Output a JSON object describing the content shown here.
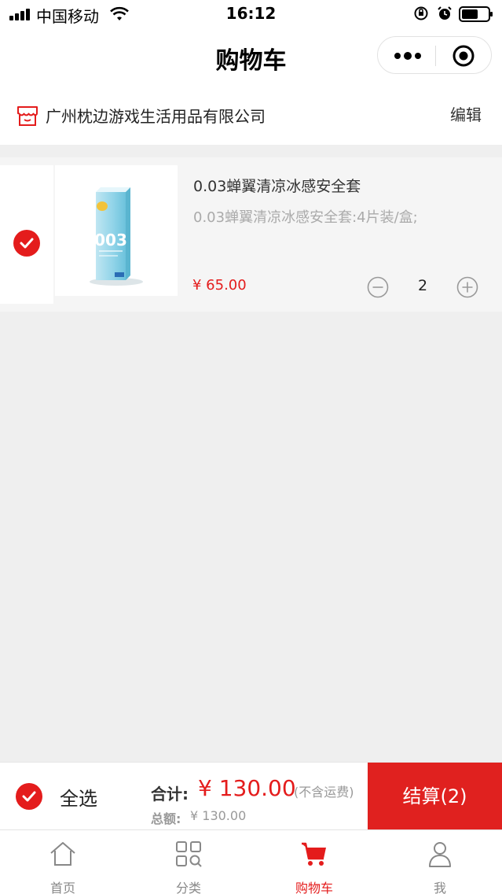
{
  "status_bar": {
    "carrier": "中国移动",
    "time": "16:12"
  },
  "nav": {
    "title": "购物车"
  },
  "store": {
    "name": "广州枕边游戏生活用品有限公司",
    "edit_label": "编辑"
  },
  "cart_items": [
    {
      "title": "0.03蝉翼清凉冰感安全套",
      "spec": "0.03蝉翼清凉冰感安全套:4片装/盒;",
      "price": "¥ 65.00",
      "quantity": "2",
      "thumb_text": "003",
      "selected": true
    }
  ],
  "checkout": {
    "select_all_label": "全选",
    "sum_label": "合计:",
    "sum_value": "¥ 130.00",
    "sum_note": "(不含运费)",
    "total_label": "总额:",
    "total_value": "¥ 130.00",
    "pay_label": "结算(2)"
  },
  "tabs": [
    {
      "label": "首页",
      "icon": "home-icon",
      "active": false
    },
    {
      "label": "分类",
      "icon": "category-icon",
      "active": false
    },
    {
      "label": "购物车",
      "icon": "cart-icon",
      "active": true
    },
    {
      "label": "我",
      "icon": "user-icon",
      "active": false
    }
  ],
  "colors": {
    "accent": "#e41c1c",
    "pay_button": "#e0211f",
    "background": "#efefef"
  }
}
